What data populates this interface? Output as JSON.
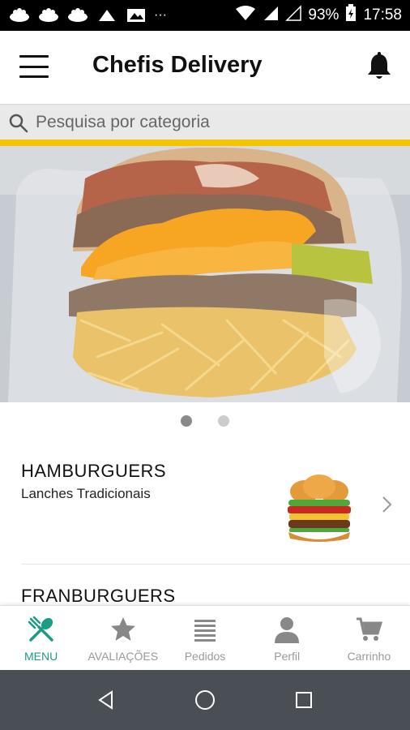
{
  "status_bar": {
    "battery": "93%",
    "time": "17:58",
    "notification_icons": [
      "notification-icon-1",
      "notification-icon-2",
      "notification-icon-3",
      "notification-icon-4",
      "image-icon"
    ],
    "more": "···"
  },
  "app_bar": {
    "title": "Chefis Delivery"
  },
  "search": {
    "placeholder": "Pesquisa por categoria"
  },
  "banner": {
    "slides": 2,
    "active_slide": 1
  },
  "categories": [
    {
      "title": "HAMBURGUERS",
      "subtitle": "Lanches Tradicionais"
    },
    {
      "title": "FRANBURGUERS",
      "subtitle": ""
    }
  ],
  "bottom_nav": {
    "items": [
      {
        "label": "MENU",
        "icon": "fork-spoon-icon",
        "active": true
      },
      {
        "label": "AVALIAÇÕES",
        "icon": "star-icon",
        "active": false
      },
      {
        "label": "Pedidos",
        "icon": "list-icon",
        "active": false
      },
      {
        "label": "Perfil",
        "icon": "person-icon",
        "active": false
      },
      {
        "label": "Carrinho",
        "icon": "cart-icon",
        "active": false
      }
    ]
  },
  "colors": {
    "accent_yellow": "#f5c400",
    "active_teal": "#1b9c85",
    "inactive_gray": "#999999"
  }
}
